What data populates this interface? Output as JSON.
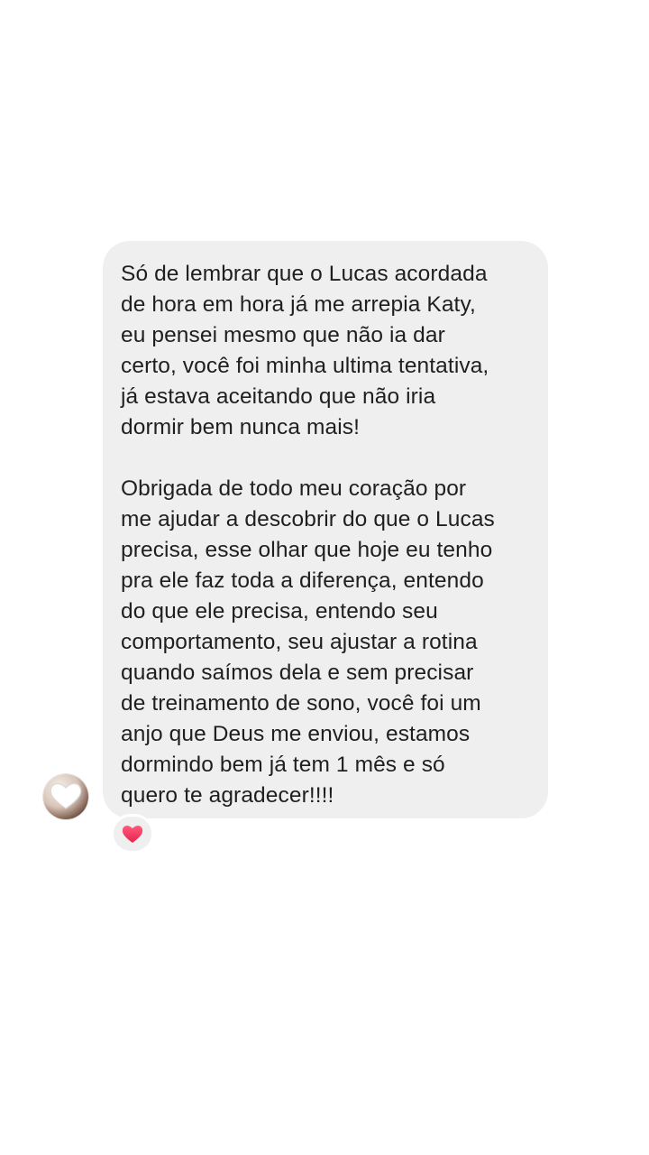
{
  "conversation": {
    "message": {
      "paragraphs": [
        "Só de lembrar que o Lucas acordada\nde hora em hora já me arrepia Katy,\neu pensei mesmo que não ia dar\ncerto, você foi minha ultima tentativa,\njá estava aceitando que não iria\ndormir bem nunca mais!",
        "Obrigada de todo meu coração por\nme ajudar a descobrir do que o Lucas\nprecisa, esse olhar que hoje eu tenho\npra ele faz toda a diferença, entendo\ndo que ele precisa, entendo seu\ncomportamento, seu ajustar a rotina\nquando saímos dela e sem precisar\nde treinamento de sono, você foi um\nanjo que Deus me enviou, estamos\ndormindo bem já tem 1 mês e só\nquero te agradecer!!!!"
      ]
    },
    "reaction": {
      "icon": "heart-icon",
      "color": "#f0375a"
    },
    "avatar": {
      "icon": "white-heart-icon"
    }
  },
  "theme": {
    "background": "#ffffff",
    "bubble_color": "#efefef",
    "text_color": "#1f1f1f"
  }
}
